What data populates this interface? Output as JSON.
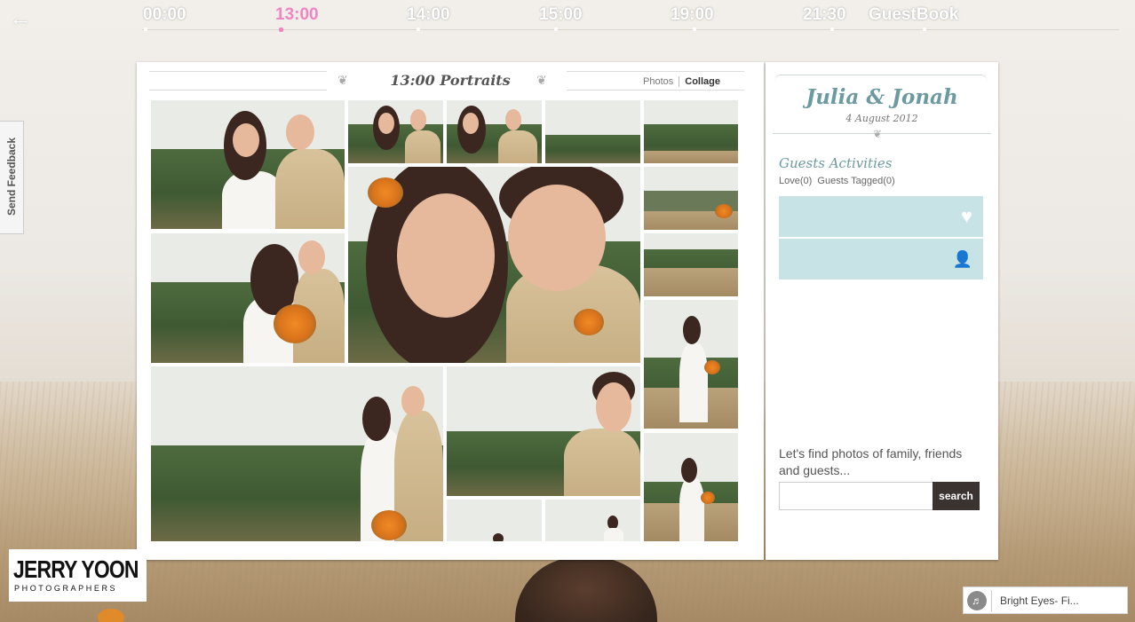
{
  "timeline": {
    "items": [
      {
        "label": "00:00",
        "active": false
      },
      {
        "label": "13:00",
        "active": true
      },
      {
        "label": "14:00",
        "active": false
      },
      {
        "label": "15:00",
        "active": false
      },
      {
        "label": "19:00",
        "active": false
      },
      {
        "label": "21:30",
        "active": false
      },
      {
        "label": "GuestBook",
        "active": false
      }
    ]
  },
  "feedback": {
    "label": "Send Feedback"
  },
  "album": {
    "section_title": "13:00 Portraits",
    "view_photos": "Photos",
    "view_collage": "Collage",
    "active_view": "Collage"
  },
  "event": {
    "couple": "Julia & Jonah",
    "date": "4 August 2012"
  },
  "guests": {
    "title": "Guests Activities",
    "love_label": "Love(0)",
    "tagged_label": "Guests Tagged(0)"
  },
  "search": {
    "prompt": "Let's find photos of family, friends and guests...",
    "placeholder": "",
    "value": "",
    "button": "search"
  },
  "logo": {
    "name": "JERRY YOON",
    "sub": "PHOTOGRAPHERS"
  },
  "player": {
    "track": "Bright Eyes- Fi..."
  },
  "icons": {
    "back": "arrow-left-icon",
    "love": "heart-icon",
    "tag": "add-user-icon",
    "speaker": "speaker-icon"
  },
  "colors": {
    "accent_pink": "#ef86c3",
    "teal": "#6c9aa0",
    "activity_box": "#c8e3e6",
    "search_button": "#3a3330"
  }
}
